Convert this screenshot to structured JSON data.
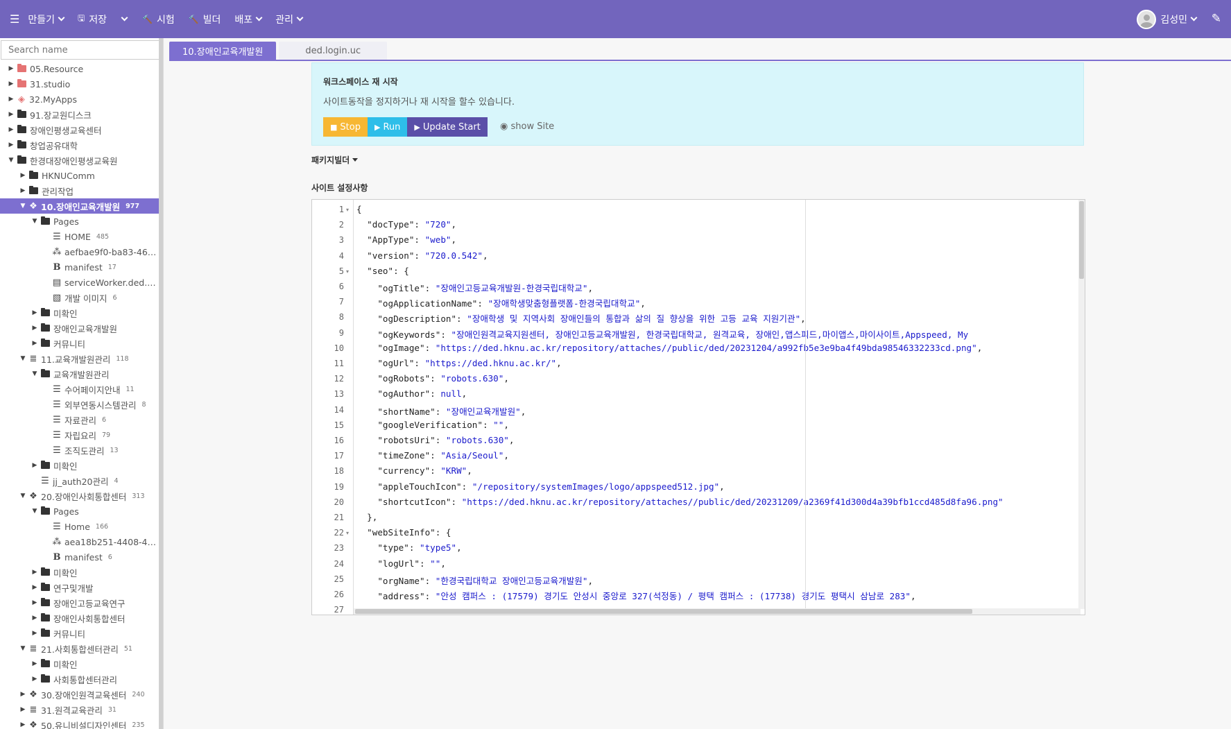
{
  "topbar": {
    "menu_icon": "hamburger-icon",
    "create": "만들기",
    "save": "저장",
    "test": "시험",
    "build": "빌더",
    "deploy": "배포",
    "manage": "관리",
    "user_name": "김성민",
    "pin_icon": "pin-icon",
    "bg_color": "#7265bd"
  },
  "sidebar": {
    "search_placeholder": "Search name",
    "tree": [
      {
        "label": "05.Resource",
        "count": "",
        "indent": 0,
        "toggle": "collapsed",
        "icon": "folder-red"
      },
      {
        "label": "31.studio",
        "count": "",
        "indent": 0,
        "toggle": "collapsed",
        "icon": "folder-red"
      },
      {
        "label": "32.MyApps",
        "count": "",
        "indent": 0,
        "toggle": "collapsed",
        "icon": "cube-red"
      },
      {
        "label": "91.장교원디스크",
        "count": "",
        "indent": 0,
        "toggle": "collapsed",
        "icon": "folder"
      },
      {
        "label": "장애인평생교육센터",
        "count": "",
        "indent": 0,
        "toggle": "collapsed",
        "icon": "folder"
      },
      {
        "label": "창업공유대학",
        "count": "",
        "indent": 0,
        "toggle": "collapsed",
        "icon": "folder"
      },
      {
        "label": "한경대장애인평생교육원",
        "count": "",
        "indent": 0,
        "toggle": "expanded",
        "icon": "folder"
      },
      {
        "label": "HKNUComm",
        "count": "",
        "indent": 1,
        "toggle": "collapsed",
        "icon": "folder"
      },
      {
        "label": "관리작업",
        "count": "",
        "indent": 1,
        "toggle": "collapsed",
        "icon": "folder"
      },
      {
        "label": "10.장애인교육개발원",
        "count": "977",
        "indent": 1,
        "toggle": "expanded",
        "icon": "cubes",
        "selected": true
      },
      {
        "label": "Pages",
        "count": "",
        "indent": 2,
        "toggle": "expanded",
        "icon": "folder"
      },
      {
        "label": "HOME",
        "count": "485",
        "indent": 3,
        "toggle": "",
        "icon": "list"
      },
      {
        "label": "aefbae9f0-ba83-46…",
        "count": "",
        "indent": 3,
        "toggle": "",
        "icon": "sitemap"
      },
      {
        "label": "manifest",
        "count": "17",
        "indent": 3,
        "toggle": "",
        "icon": "bold"
      },
      {
        "label": "serviceWorker.ded.…",
        "count": "",
        "indent": 3,
        "toggle": "",
        "icon": "file"
      },
      {
        "label": "개발 이미지",
        "count": "6",
        "indent": 3,
        "toggle": "",
        "icon": "image"
      },
      {
        "label": "미확인",
        "count": "",
        "indent": 2,
        "toggle": "collapsed",
        "icon": "folder"
      },
      {
        "label": "장애인교육개발원",
        "count": "",
        "indent": 2,
        "toggle": "collapsed",
        "icon": "folder"
      },
      {
        "label": "커뮤니티",
        "count": "",
        "indent": 2,
        "toggle": "collapsed",
        "icon": "folder"
      },
      {
        "label": "11.교육개발원관리",
        "count": "118",
        "indent": 1,
        "toggle": "expanded",
        "icon": "database"
      },
      {
        "label": "교육개발원관리",
        "count": "",
        "indent": 2,
        "toggle": "expanded",
        "icon": "folder"
      },
      {
        "label": "수어페이지안내",
        "count": "11",
        "indent": 3,
        "toggle": "",
        "icon": "list"
      },
      {
        "label": "외부연동시스템관리",
        "count": "8",
        "indent": 3,
        "toggle": "",
        "icon": "list"
      },
      {
        "label": "자료관리",
        "count": "6",
        "indent": 3,
        "toggle": "",
        "icon": "list"
      },
      {
        "label": "자립요리",
        "count": "79",
        "indent": 3,
        "toggle": "",
        "icon": "list"
      },
      {
        "label": "조직도관리",
        "count": "13",
        "indent": 3,
        "toggle": "",
        "icon": "list"
      },
      {
        "label": "미확인",
        "count": "",
        "indent": 2,
        "toggle": "collapsed",
        "icon": "folder"
      },
      {
        "label": "jj_auth20관리",
        "count": "4",
        "indent": 2,
        "toggle": "",
        "icon": "list"
      },
      {
        "label": "20.장애인사회통합센터",
        "count": "313",
        "indent": 1,
        "toggle": "expanded",
        "icon": "cubes"
      },
      {
        "label": "Pages",
        "count": "",
        "indent": 2,
        "toggle": "expanded",
        "icon": "folder"
      },
      {
        "label": "Home",
        "count": "166",
        "indent": 3,
        "toggle": "",
        "icon": "list"
      },
      {
        "label": "aea18b251-4408-4…",
        "count": "",
        "indent": 3,
        "toggle": "",
        "icon": "sitemap"
      },
      {
        "label": "manifest",
        "count": "6",
        "indent": 3,
        "toggle": "",
        "icon": "bold"
      },
      {
        "label": "미확인",
        "count": "",
        "indent": 2,
        "toggle": "collapsed",
        "icon": "folder"
      },
      {
        "label": "연구및개발",
        "count": "",
        "indent": 2,
        "toggle": "collapsed",
        "icon": "folder"
      },
      {
        "label": "장애인고등교육연구",
        "count": "",
        "indent": 2,
        "toggle": "collapsed",
        "icon": "folder"
      },
      {
        "label": "장애인사회통합센터",
        "count": "",
        "indent": 2,
        "toggle": "collapsed",
        "icon": "folder"
      },
      {
        "label": "커뮤니티",
        "count": "",
        "indent": 2,
        "toggle": "collapsed",
        "icon": "folder"
      },
      {
        "label": "21.사회통합센터관리",
        "count": "51",
        "indent": 1,
        "toggle": "expanded",
        "icon": "database"
      },
      {
        "label": "미확인",
        "count": "",
        "indent": 2,
        "toggle": "collapsed",
        "icon": "folder"
      },
      {
        "label": "사회통합센터관리",
        "count": "",
        "indent": 2,
        "toggle": "collapsed",
        "icon": "folder"
      },
      {
        "label": "30.장애인원격교육센터",
        "count": "240",
        "indent": 1,
        "toggle": "collapsed",
        "icon": "cubes"
      },
      {
        "label": "31.원격교육관리",
        "count": "31",
        "indent": 1,
        "toggle": "collapsed",
        "icon": "database"
      },
      {
        "label": "50.유니비설디자인센터",
        "count": "235",
        "indent": 1,
        "toggle": "collapsed",
        "icon": "cubes"
      }
    ]
  },
  "tabs": [
    {
      "label": "10.장애인교육개발원",
      "active": true
    },
    {
      "label": "ded.login.uc",
      "active": false
    }
  ],
  "workspace": {
    "title": "워크스페이스 재 시작",
    "description": "사이트동작을 정지하거나 재 시작을 할수 있습니다.",
    "stop_label": "Stop",
    "run_label": "Run",
    "update_label": "Update Start",
    "show_site_label": "show Site",
    "stop_color": "#f7b733",
    "run_color": "#2ebee9",
    "update_color": "#5a4fa8"
  },
  "package_builder": "패키지빌더",
  "site_settings": "사이트 설정사항",
  "editor": {
    "lines": [
      {
        "n": "1",
        "fold": true,
        "text": "{"
      },
      {
        "n": "2",
        "text": "  \"docType\": \"720\","
      },
      {
        "n": "3",
        "text": "  \"AppType\": \"web\","
      },
      {
        "n": "4",
        "text": "  \"version\": \"720.0.542\","
      },
      {
        "n": "5",
        "fold": true,
        "text": "  \"seo\": {"
      },
      {
        "n": "6",
        "text": "    \"ogTitle\": \"장애인고등교육개발원-한경국립대학교\","
      },
      {
        "n": "7",
        "text": "    \"ogApplicationName\": \"장애학생맞춤형플랫폼-한경국립대학교\","
      },
      {
        "n": "8",
        "text": "    \"ogDescription\": \"장애학생 및 지역사회 장애인들의 통합과 삶의 질 향상을 위한 고등 교육 지원기관\","
      },
      {
        "n": "9",
        "text": "    \"ogKeywords\": \"장애인원격교육지원센터, 장애인고등교육개발원, 한경국립대학교, 원격교육, 장애인,앱스피드,마이앱스,마이사이트,Appspeed, My"
      },
      {
        "n": "10",
        "text": "    \"ogImage\": \"https://ded.hknu.ac.kr/repository/attaches//public/ded/20231204/a992fb5e3e9ba4f49bda98546332233cd.png\","
      },
      {
        "n": "11",
        "text": "    \"ogUrl\": \"https://ded.hknu.ac.kr/\","
      },
      {
        "n": "12",
        "text": "    \"ogRobots\": \"robots.630\","
      },
      {
        "n": "13",
        "text": "    \"ogAuthor\": null,"
      },
      {
        "n": "14",
        "text": "    \"shortName\": \"장애인교육개발원\","
      },
      {
        "n": "15",
        "text": "    \"googleVerification\": \"\","
      },
      {
        "n": "16",
        "text": "    \"robotsUri\": \"robots.630\","
      },
      {
        "n": "17",
        "text": "    \"timeZone\": \"Asia/Seoul\","
      },
      {
        "n": "18",
        "text": "    \"currency\": \"KRW\","
      },
      {
        "n": "19",
        "text": "    \"appleTouchIcon\": \"/repository/systemImages/logo/appspeed512.jpg\","
      },
      {
        "n": "20",
        "text": "    \"shortcutIcon\": \"https://ded.hknu.ac.kr/repository/attaches//public/ded/20231209/a2369f41d300d4a39bfb1ccd485d8fa96.png\""
      },
      {
        "n": "21",
        "text": "  },"
      },
      {
        "n": "22",
        "fold": true,
        "text": "  \"webSiteInfo\": {"
      },
      {
        "n": "23",
        "text": "    \"type\": \"type5\","
      },
      {
        "n": "24",
        "text": "    \"logUrl\": \"\","
      },
      {
        "n": "25",
        "text": "    \"orgName\": \"한경국립대학교 장애인고등교육개발원\","
      },
      {
        "n": "26",
        "text": "    \"address\": \"안성 캠퍼스 : (17579) 경기도 안성시 중앙로 327(석정동) / 평택 캠퍼스 : (17738) 경기도 평택시 삼남로 283\","
      },
      {
        "n": "27",
        "text": ""
      }
    ]
  }
}
